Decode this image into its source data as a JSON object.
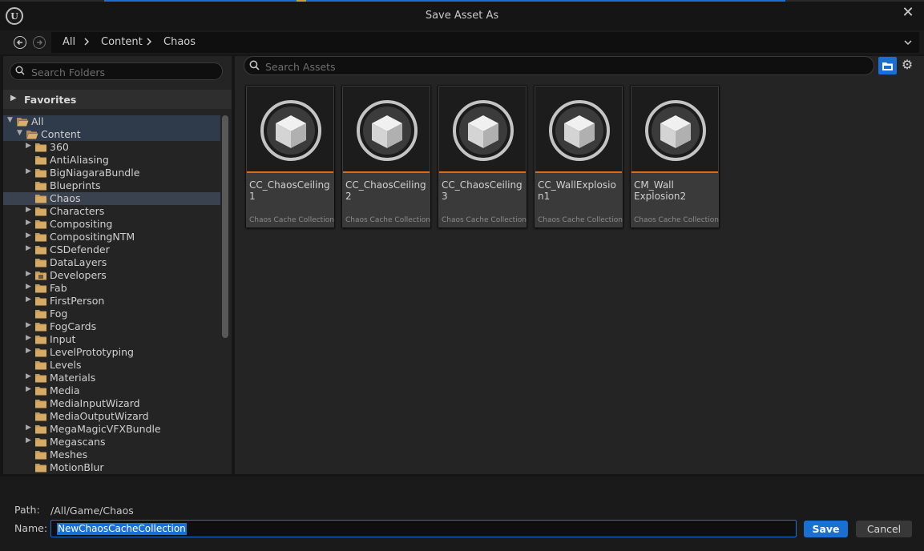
{
  "window": {
    "title": "Save Asset As",
    "close_icon": "close-icon",
    "logo_text": "U"
  },
  "nav": {
    "back_icon": "back-arrow-icon",
    "forward_icon": "forward-arrow-icon",
    "breadcrumbs": [
      "All",
      "Content",
      "Chaos"
    ],
    "dropdown_icon": "chevron-down-icon"
  },
  "folders": {
    "search_placeholder": "Search Folders",
    "favorites_label": "Favorites",
    "tree": [
      {
        "label": "All",
        "depth": 0,
        "expanded": true,
        "arrow": "down",
        "open": true
      },
      {
        "label": "Content",
        "depth": 1,
        "expanded": true,
        "arrow": "down",
        "open": true
      },
      {
        "label": "360",
        "depth": 2,
        "arrow": "right"
      },
      {
        "label": "AntiAliasing",
        "depth": 2,
        "arrow": "none"
      },
      {
        "label": "BigNiagaraBundle",
        "depth": 2,
        "arrow": "right"
      },
      {
        "label": "Blueprints",
        "depth": 2,
        "arrow": "none"
      },
      {
        "label": "Chaos",
        "depth": 2,
        "arrow": "none",
        "selected": true
      },
      {
        "label": "Characters",
        "depth": 2,
        "arrow": "right"
      },
      {
        "label": "Compositing",
        "depth": 2,
        "arrow": "right"
      },
      {
        "label": "CompositingNTM",
        "depth": 2,
        "arrow": "right"
      },
      {
        "label": "CSDefender",
        "depth": 2,
        "arrow": "right"
      },
      {
        "label": "DataLayers",
        "depth": 2,
        "arrow": "none"
      },
      {
        "label": "Developers",
        "depth": 2,
        "arrow": "right",
        "special": true
      },
      {
        "label": "Fab",
        "depth": 2,
        "arrow": "right"
      },
      {
        "label": "FirstPerson",
        "depth": 2,
        "arrow": "right"
      },
      {
        "label": "Fog",
        "depth": 2,
        "arrow": "none"
      },
      {
        "label": "FogCards",
        "depth": 2,
        "arrow": "right"
      },
      {
        "label": "Input",
        "depth": 2,
        "arrow": "right"
      },
      {
        "label": "LevelPrototyping",
        "depth": 2,
        "arrow": "right"
      },
      {
        "label": "Levels",
        "depth": 2,
        "arrow": "none"
      },
      {
        "label": "Materials",
        "depth": 2,
        "arrow": "right"
      },
      {
        "label": "Media",
        "depth": 2,
        "arrow": "right"
      },
      {
        "label": "MediaInputWizard",
        "depth": 2,
        "arrow": "none"
      },
      {
        "label": "MediaOutputWizard",
        "depth": 2,
        "arrow": "none"
      },
      {
        "label": "MegaMagicVFXBundle",
        "depth": 2,
        "arrow": "right"
      },
      {
        "label": "Megascans",
        "depth": 2,
        "arrow": "right"
      },
      {
        "label": "Meshes",
        "depth": 2,
        "arrow": "none"
      },
      {
        "label": "MotionBlur",
        "depth": 2,
        "arrow": "none"
      }
    ]
  },
  "assets": {
    "search_placeholder": "Search Assets",
    "folder_icon": "folder-view-icon",
    "settings_icon": "gear-icon",
    "items": [
      {
        "name": "CC_ChaosCeiling1",
        "type": "Chaos Cache Collection",
        "accent": "#d86d1c"
      },
      {
        "name": "CC_ChaosCeiling2",
        "type": "Chaos Cache Collection",
        "accent": "#d86d1c"
      },
      {
        "name": "CC_ChaosCeiling3",
        "type": "Chaos Cache Collection",
        "accent": "#d86d1c"
      },
      {
        "name": "CC_WallExplosion1",
        "type": "Chaos Cache Collection",
        "accent": "#d86d1c"
      },
      {
        "name": "CM_Wall\nExplosion2",
        "type": "Chaos Cache Collection",
        "accent": "#d86d1c"
      }
    ]
  },
  "footer": {
    "path_label": "Path:",
    "path_value": "/All/Game/Chaos",
    "name_label": "Name:",
    "name_value": "NewChaosCacheCollection",
    "save_label": "Save",
    "cancel_label": "Cancel"
  },
  "colors": {
    "accent_blue": "#1a6fd2",
    "asset_bar": "#d86d1c",
    "selected_row": "#3a4250",
    "background": "#151515"
  }
}
